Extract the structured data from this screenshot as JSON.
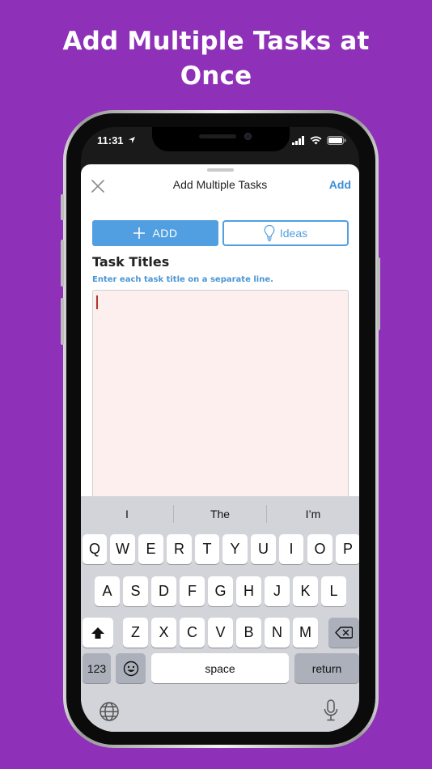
{
  "headline": {
    "line1": "Add Multiple Tasks at",
    "line2": "Once"
  },
  "status_bar": {
    "time": "11:31"
  },
  "sheet": {
    "title": "Add Multiple Tasks",
    "add_label": "Add",
    "add_button_label": "ADD",
    "ideas_button_label": "Ideas",
    "section_title": "Task Titles",
    "hint": "Enter each task title on a separate line."
  },
  "keyboard": {
    "suggestions": [
      "I",
      "The",
      "I’m"
    ],
    "row1": [
      "Q",
      "W",
      "E",
      "R",
      "T",
      "Y",
      "U",
      "I",
      "O",
      "P"
    ],
    "row2": [
      "A",
      "S",
      "D",
      "F",
      "G",
      "H",
      "J",
      "K",
      "L"
    ],
    "row3": [
      "Z",
      "X",
      "C",
      "V",
      "B",
      "N",
      "M"
    ],
    "numbers_label": "123",
    "space_label": "space",
    "return_label": "return"
  },
  "colors": {
    "background": "#8e30b8",
    "accent": "#519fe0",
    "input_bg": "#fcefee"
  }
}
